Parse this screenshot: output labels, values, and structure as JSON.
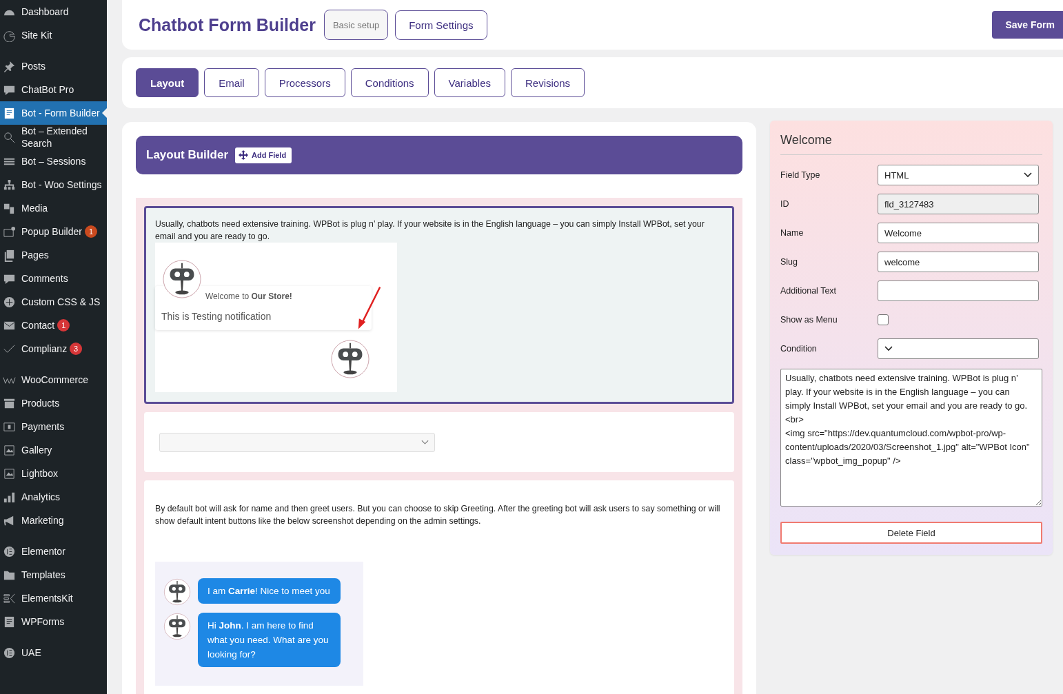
{
  "sidebar": {
    "groups": [
      {
        "items": [
          {
            "label": "Dashboard",
            "selected": false
          },
          {
            "label": "Site Kit",
            "selected": false
          }
        ]
      },
      {
        "items": [
          {
            "label": "Posts",
            "selected": false
          },
          {
            "label": "ChatBot Pro",
            "selected": false
          },
          {
            "label": "Bot - Form Builder",
            "selected": true
          },
          {
            "label": "Bot – Extended Search",
            "selected": false
          },
          {
            "label": "Bot – Sessions",
            "selected": false
          },
          {
            "label": "Bot - Woo Settings",
            "selected": false
          },
          {
            "label": "Media",
            "selected": false
          },
          {
            "label": "Popup Builder",
            "selected": false,
            "badge": "1",
            "color": "#ca4a1f"
          },
          {
            "label": "Pages",
            "selected": false
          },
          {
            "label": "Comments",
            "selected": false
          },
          {
            "label": "Custom CSS & JS",
            "selected": false
          },
          {
            "label": "Contact",
            "selected": false,
            "badge": "1",
            "color": "#d63638"
          },
          {
            "label": "Complianz",
            "selected": false,
            "badge": "3",
            "color": "#d63638"
          }
        ]
      },
      {
        "items": [
          {
            "label": "WooCommerce",
            "selected": false
          },
          {
            "label": "Products",
            "selected": false
          },
          {
            "label": "Payments",
            "selected": false
          },
          {
            "label": "Gallery",
            "selected": false
          },
          {
            "label": "Lightbox",
            "selected": false
          },
          {
            "label": "Analytics",
            "selected": false
          },
          {
            "label": "Marketing",
            "selected": false
          }
        ]
      },
      {
        "items": [
          {
            "label": "Elementor",
            "selected": false
          },
          {
            "label": "Templates",
            "selected": false
          },
          {
            "label": "ElementsKit",
            "selected": false
          },
          {
            "label": "WPForms",
            "selected": false
          }
        ]
      },
      {
        "items": [
          {
            "label": "UAE",
            "selected": false
          }
        ]
      }
    ]
  },
  "header": {
    "title": "Chatbot Form Builder",
    "buttons": [
      {
        "label": "Basic setup",
        "kind": "muted"
      },
      {
        "label": "Form Settings",
        "kind": "outline"
      }
    ],
    "save_button": "Save Form"
  },
  "tabs": [
    {
      "label": "Layout",
      "selected": true
    },
    {
      "label": "Email",
      "selected": false
    },
    {
      "label": "Processors",
      "selected": false
    },
    {
      "label": "Conditions",
      "selected": false
    },
    {
      "label": "Variables",
      "selected": false
    },
    {
      "label": "Revisions",
      "selected": false
    }
  ],
  "layout_builder": {
    "title": "Layout Builder",
    "add_field_button": "Add Field",
    "fields": [
      {
        "kind": "notification",
        "selected": true,
        "text": "Usually, chatbots need extensive training. WPBot is plug n’ play. If your website is in the English language – you can simply Install WPBot, set your email and you are ready to go.",
        "greeting": "Welcome to **Our Store!**",
        "notification": "This is Testing notification"
      },
      {
        "kind": "dropdown",
        "selected": false
      },
      {
        "kind": "chat",
        "selected": false,
        "text": "By default bot will ask for name and then greet users. But you can choose to skip Greeting. After the greeting bot will ask users to say something or will show default intent buttons like the below screenshot depending on the admin settings.",
        "messages": [
          "I am **Carrie**! Nice to meet you",
          "Hi **John**. I am here to find what you need. What are you looking for?"
        ]
      }
    ]
  },
  "field_panel": {
    "title": "Welcome",
    "rows": [
      {
        "label": "Field Type",
        "kind": "select",
        "value": "HTML"
      },
      {
        "label": "ID",
        "kind": "readonly",
        "value": "fld_3127483"
      },
      {
        "label": "Name",
        "kind": "text",
        "value": "Welcome"
      },
      {
        "label": "Slug",
        "kind": "text",
        "value": "welcome"
      },
      {
        "label": "Additional Text",
        "kind": "text"
      },
      {
        "label": "Show as Menu",
        "kind": "checkbox",
        "checked": false
      },
      {
        "label": "Condition",
        "kind": "select"
      }
    ],
    "content": "Usually, chatbots need extensive training. WPBot is plug n’ play. If your website is in the English language – you can simply Install WPBot, set your email and you are ready to go.\n<br>\n<img src=\"https://dev.quantumcloud.com/wpbot-pro/wp-content/uploads/2020/03/Screenshot_1.jpg\" alt=\"WPBot Icon\" class=\"wpbot_img_popup\" />",
    "delete_button": "Delete Field"
  }
}
